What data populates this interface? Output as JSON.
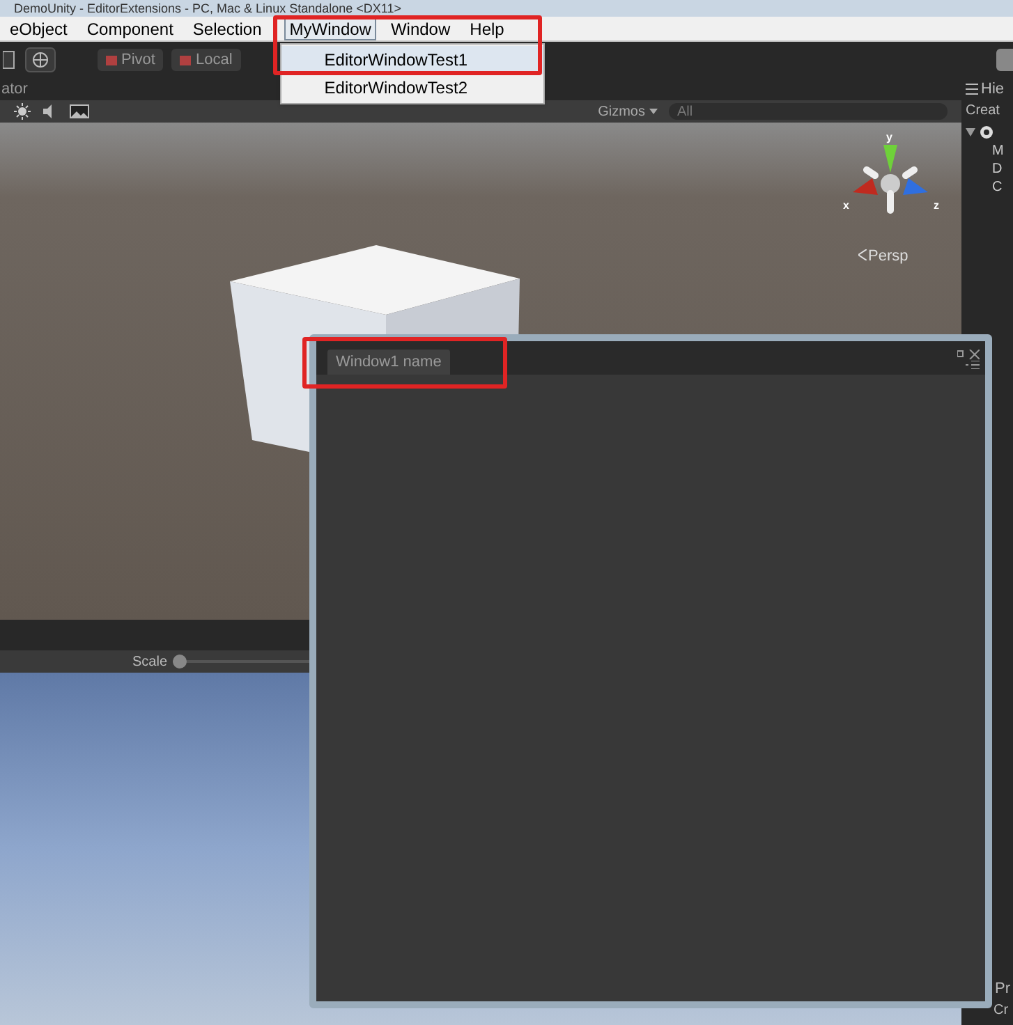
{
  "title_bar": {
    "title": "DemoUnity - EditorExtensions - PC, Mac & Linux Standalone <DX11>"
  },
  "menu_bar": [
    {
      "label": "eObject",
      "selected": false
    },
    {
      "label": "Component",
      "selected": false
    },
    {
      "label": "Selection",
      "selected": false
    },
    {
      "label": "MyWindow",
      "selected": true
    },
    {
      "label": "Window",
      "selected": false
    },
    {
      "label": "Help",
      "selected": false
    }
  ],
  "dropdown": [
    {
      "label": "EditorWindowTest1",
      "selected": true
    },
    {
      "label": "EditorWindowTest2",
      "selected": false
    }
  ],
  "toolbar": {
    "buttons": [
      "Pivot",
      "Local"
    ]
  },
  "scene_view": {
    "tab": "ator",
    "gizmos": "Gizmos",
    "search_placeholder": "All",
    "axes": {
      "y": "y",
      "x": "x",
      "z": "z"
    },
    "projection": "Persp"
  },
  "game_view": {
    "scale": {
      "label": "Scale",
      "level": 0
    }
  },
  "hierarchy": {
    "tab": "Hie",
    "create": "Creat",
    "items": [
      "M",
      "D",
      "C"
    ]
  },
  "project": {
    "tab": "Pr",
    "create": "Cr"
  },
  "floating_window": {
    "tab": "Window1 name"
  }
}
